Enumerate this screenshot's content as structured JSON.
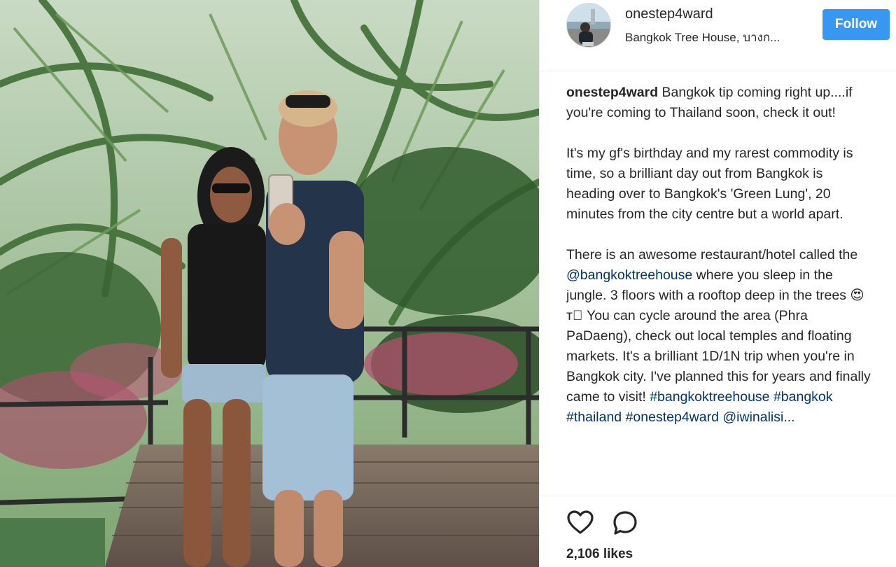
{
  "post": {
    "photo_icon": "photo-of-couple-taking-mirror-selfie-in-jungle"
  },
  "header": {
    "username": "onestep4ward",
    "location": "Bangkok Tree House, บางก...",
    "follow_label": "Follow"
  },
  "caption": {
    "username": "onestep4ward",
    "p1": "Bangkok tip coming right up....if you're coming to Thailand soon, check it out!",
    "p2": "It's my gf's birthday and my rarest commodity is time, so a brilliant day out from Bangkok is heading over to Bangkok's 'Green Lung', 20 minutes from the city centre but a world apart.",
    "p3_a": "There is an awesome restaurant/hotel called the ",
    "p3_mention": "@bangkoktreehouse",
    "p3_b": " where you sleep in the jungle. 3 floors with a rooftop deep in the trees 😍т\u0000 You can cycle around the area (Phra PaDaeng), check out local temples and floating markets. It's a brilliant 1D/1N trip when you're in Bangkok city. I've planned this for years and finally came to visit! ",
    "tag1": "#bangkoktreehouse",
    "tag2": "#bangkok",
    "tag3": "#thailand",
    "tag4": "#onestep4ward",
    "tag5": "@iwinalisi..."
  },
  "actions": {
    "like_icon": "heart-outline-icon",
    "comment_icon": "comment-bubble-icon",
    "likes_text": "2,106 likes"
  },
  "colors": {
    "follow_bg": "#3897f0",
    "link": "#003569",
    "text": "#262626"
  }
}
